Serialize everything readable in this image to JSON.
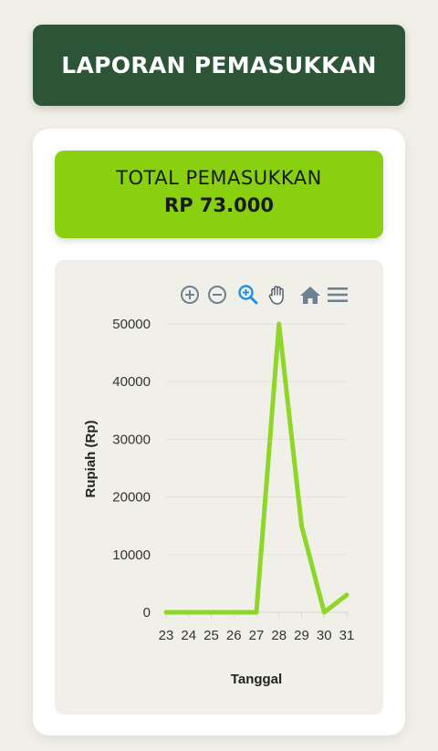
{
  "header": {
    "title": "LAPORAN PEMASUKKAN"
  },
  "summary": {
    "label": "TOTAL PEMASUKKAN",
    "value": "RP 73.000"
  },
  "toolbar": {
    "tools": [
      "zoom-in-icon",
      "zoom-out-icon",
      "zoom-selection-icon",
      "pan-icon",
      "reset-home-icon",
      "menu-icon"
    ],
    "accent_color": "#1e90e6",
    "icon_color": "#6e8192"
  },
  "chart_data": {
    "type": "line",
    "categories": [
      "23",
      "24",
      "25",
      "26",
      "27",
      "28",
      "29",
      "30",
      "31"
    ],
    "series": [
      {
        "values": [
          0,
          0,
          0,
          0,
          0,
          50000,
          15000,
          0,
          3000
        ]
      }
    ],
    "y_ticks": [
      "0",
      "10000",
      "20000",
      "30000",
      "40000",
      "50000"
    ],
    "xlabel": "Tanggal",
    "ylabel": "Rupiah (Rp)",
    "ylim": [
      0,
      50000
    ],
    "grid": true,
    "line_color": "#8fd62a"
  }
}
